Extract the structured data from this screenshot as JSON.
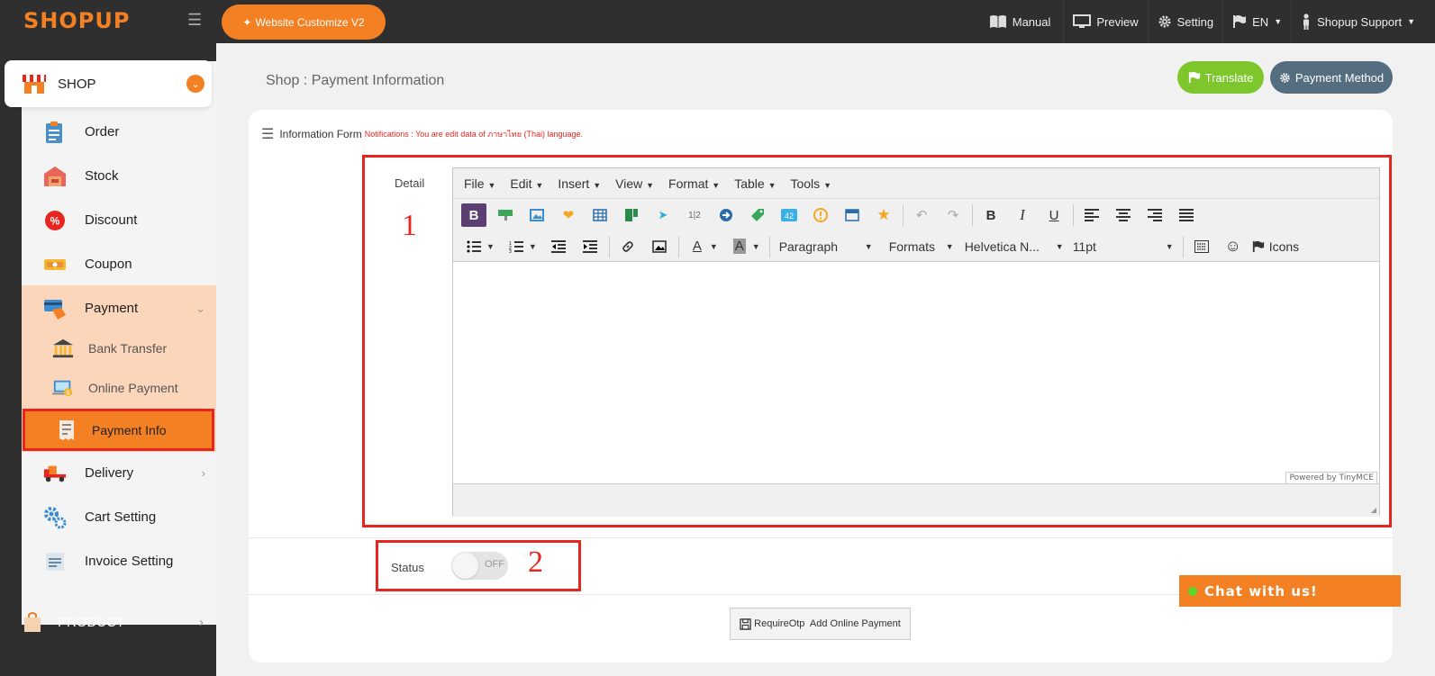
{
  "header": {
    "logo": "SHOPUP",
    "customize_label": "Website Customize V2",
    "nav": {
      "manual": "Manual",
      "preview": "Preview",
      "setting": "Setting",
      "language": "EN",
      "user": "Shopup Support"
    }
  },
  "sidebar": {
    "shop_label": "SHOP",
    "items": [
      {
        "label": "Order",
        "icon": "order-icon"
      },
      {
        "label": "Stock",
        "icon": "stock-icon"
      },
      {
        "label": "Discount",
        "icon": "discount-icon"
      },
      {
        "label": "Coupon",
        "icon": "coupon-icon"
      },
      {
        "label": "Payment",
        "icon": "payment-icon"
      },
      {
        "label": "Delivery",
        "icon": "delivery-icon"
      },
      {
        "label": "Cart Setting",
        "icon": "cart-setting-icon"
      },
      {
        "label": "Invoice Setting",
        "icon": "invoice-icon"
      }
    ],
    "payment_sub": [
      {
        "label": "Bank Transfer",
        "icon": "bank-icon"
      },
      {
        "label": "Online Payment",
        "icon": "online-payment-icon"
      },
      {
        "label": "Payment Info",
        "icon": "payment-info-icon"
      }
    ],
    "product_label": "PRODUCT"
  },
  "main": {
    "title": "Shop : Payment Information",
    "translate_label": "Translate",
    "payment_method_label": "Payment Method",
    "form_title": "Information Form",
    "notification": "Notifications : You are edit data of ภาษาไทย (Thai) language.",
    "detail_label": "Detail",
    "annotation_1": "1",
    "annotation_2": "2",
    "status_label": "Status",
    "status_value": "OFF",
    "save_label": "RequireOtp  Add Online Payment"
  },
  "editor": {
    "menus": [
      "File",
      "Edit",
      "Insert",
      "View",
      "Format",
      "Table",
      "Tools"
    ],
    "paragraph": "Paragraph",
    "formats": "Formats",
    "font": "Helvetica N...",
    "size": "11pt",
    "icons_label": "Icons",
    "powered": "Powered by TinyMCE"
  },
  "chat": {
    "label": "Chat with us!"
  },
  "colors": {
    "accent": "#f48024",
    "highlight": "#e6261f",
    "translate": "#7dc72c",
    "payment_method": "#546e7f"
  }
}
